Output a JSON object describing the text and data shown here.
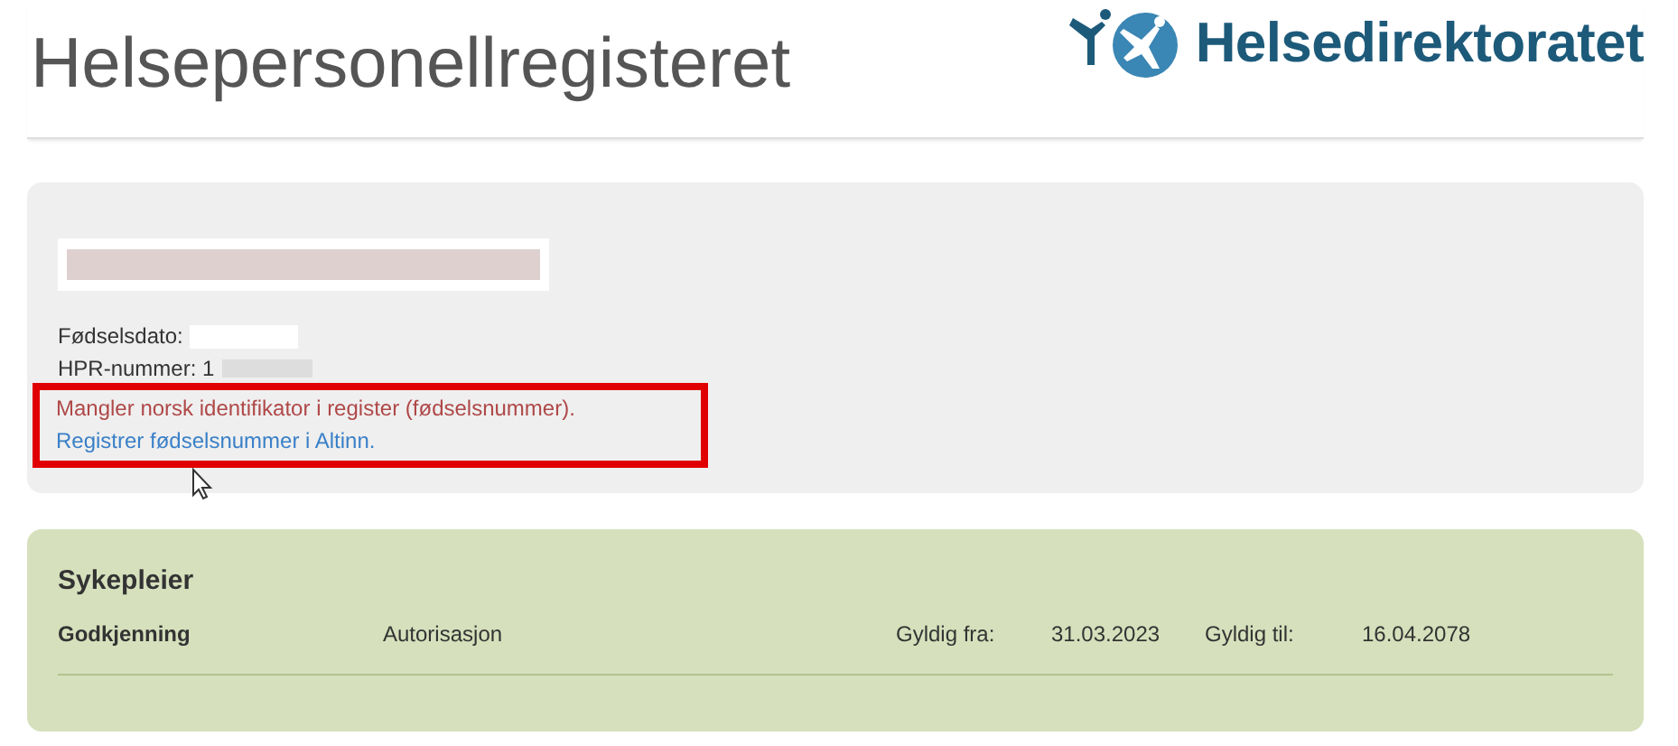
{
  "header": {
    "title": "Helsepersonellregisteret",
    "logo_text": "Helsedirektoratet"
  },
  "person": {
    "birth_label": "Fødselsdato:",
    "hpr_label": "HPR-nummer: 1",
    "warning": "Mangler norsk identifikator i register (fødselsnummer).",
    "link": "Registrer fødselsnummer i Altinn."
  },
  "profession": {
    "title": "Sykepleier",
    "rows": [
      {
        "type": "Godkjenning",
        "kind": "Autorisasjon",
        "from_label": "Gyldig fra:",
        "from": "31.03.2023",
        "to_label": "Gyldig til:",
        "to": "16.04.2078"
      }
    ]
  }
}
